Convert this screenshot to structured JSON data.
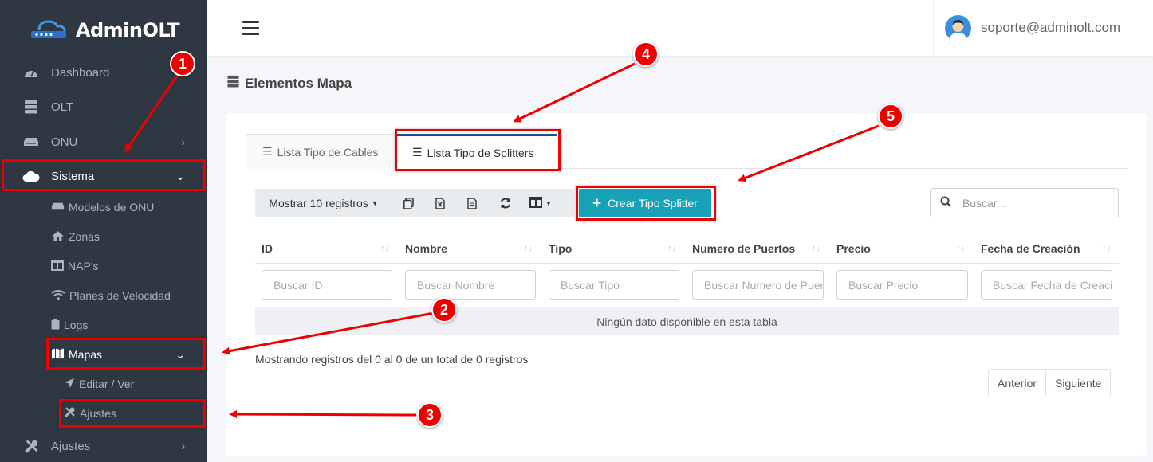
{
  "brand": {
    "name": "AdminOLT"
  },
  "sidebar": {
    "items": [
      {
        "label": "Dashboard",
        "icon": "tachometer-icon"
      },
      {
        "label": "OLT",
        "icon": "server-icon"
      },
      {
        "label": "ONU",
        "icon": "device-icon"
      },
      {
        "label": "Sistema",
        "icon": "cloud-icon"
      },
      {
        "label": "Ajustes",
        "icon": "tools-icon"
      }
    ],
    "sistema_sub": [
      {
        "label": "Modelos de ONU",
        "icon": "device-icon"
      },
      {
        "label": "Zonas",
        "icon": "home-icon"
      },
      {
        "label": "NAP's",
        "icon": "columns-icon"
      },
      {
        "label": "Planes de Velocidad",
        "icon": "wifi-icon"
      },
      {
        "label": "Logs",
        "icon": "clipboard-icon"
      },
      {
        "label": "Mapas",
        "icon": "map-icon"
      }
    ],
    "mapas_sub": [
      {
        "label": "Editar / Ver",
        "icon": "location-arrow-icon"
      },
      {
        "label": "Ajustes",
        "icon": "tools-icon"
      }
    ]
  },
  "header": {
    "user_email": "soporte@adminolt.com"
  },
  "page": {
    "title": "Elementos Mapa"
  },
  "tabs": [
    {
      "label": "Lista Tipo de Cables"
    },
    {
      "label": "Lista Tipo de Splitters"
    }
  ],
  "toolbar": {
    "show_entries": "Mostrar 10 registros",
    "create_button": "Crear Tipo Splitter",
    "search_placeholder": "Buscar..."
  },
  "table": {
    "columns": [
      "ID",
      "Nombre",
      "Tipo",
      "Numero de Puertos",
      "Precio",
      "Fecha de Creación"
    ],
    "filters": [
      "Buscar ID",
      "Buscar Nombre",
      "Buscar Tipo",
      "Buscar Numero de Puertos",
      "Buscar Precio",
      "Buscar Fecha de Creación"
    ],
    "empty_message": "Ningún dato disponible en esta tabla",
    "info": "Mostrando registros del 0 al 0 de un total de 0 registros"
  },
  "pagination": {
    "prev": "Anterior",
    "next": "Siguiente"
  },
  "annotations": [
    "1",
    "2",
    "3",
    "4",
    "5"
  ],
  "colors": {
    "sidebar": "#2f3842",
    "accent": "#17a2b8",
    "annotation": "#e00000"
  }
}
